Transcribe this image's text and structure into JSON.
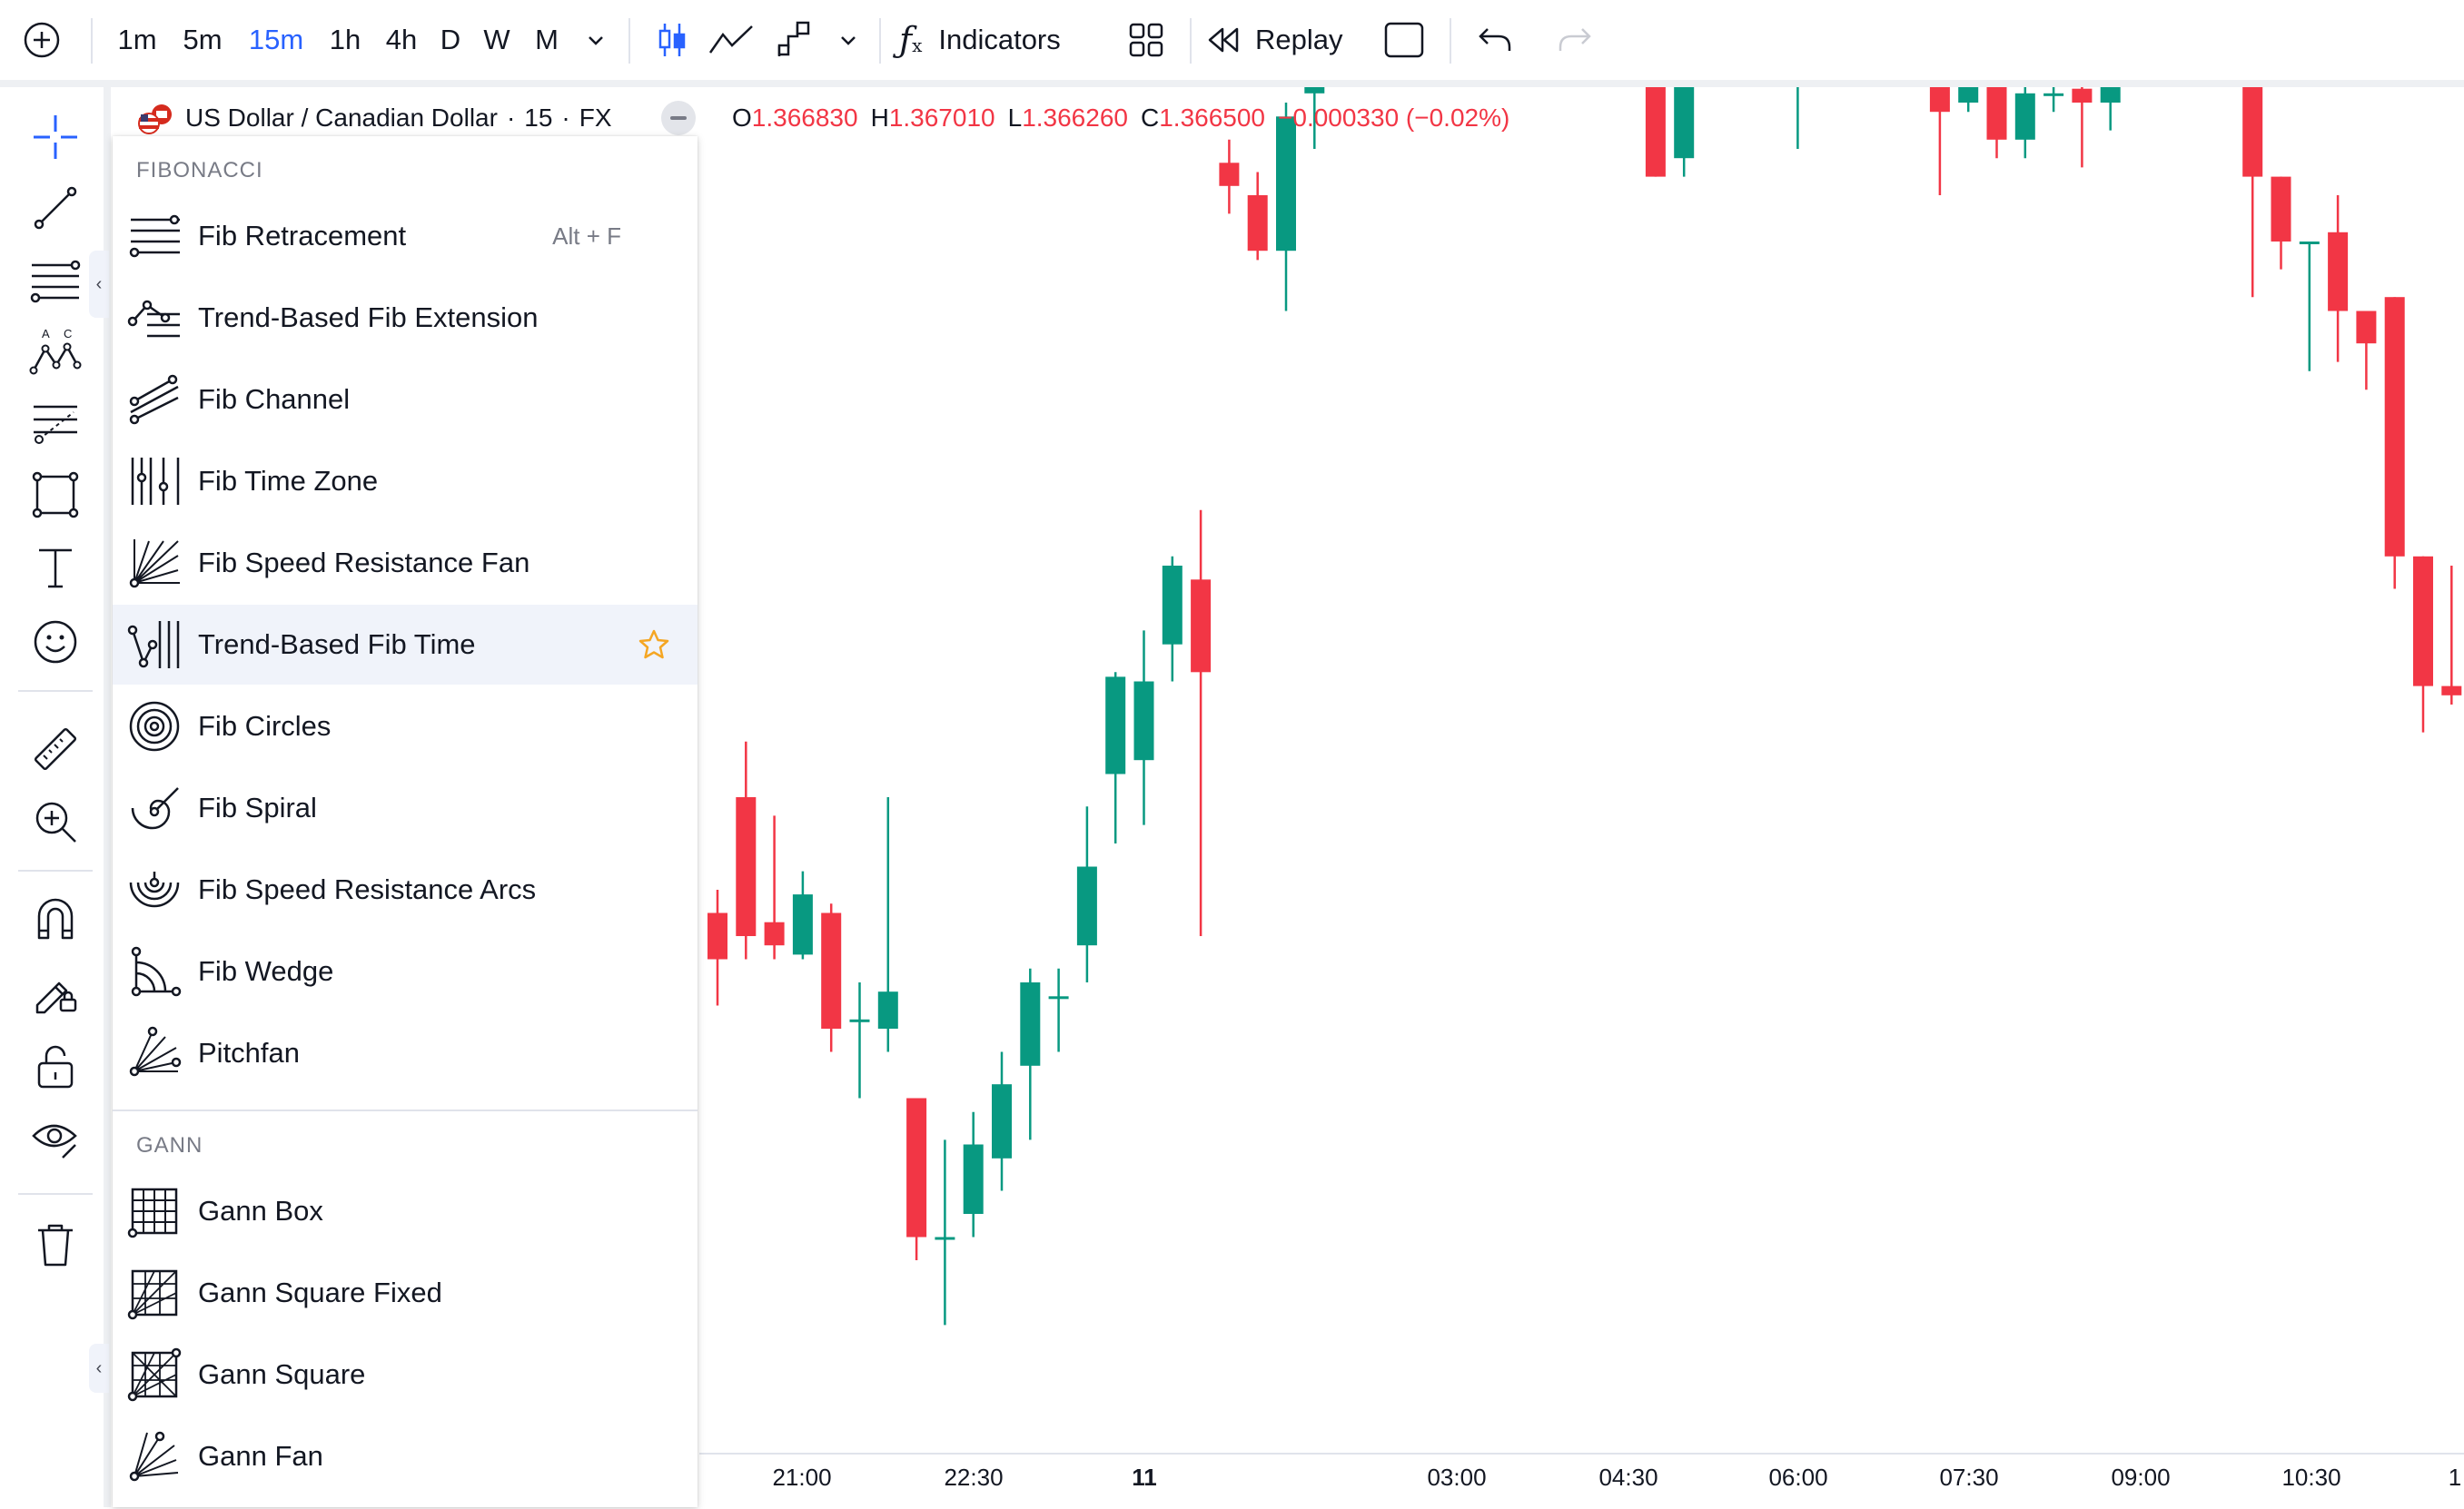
{
  "toolbar": {
    "intervals": [
      "1m",
      "5m",
      "15m",
      "1h",
      "4h",
      "D",
      "W",
      "M"
    ],
    "active_interval": "15m",
    "indicators_label": "Indicators",
    "replay_label": "Replay",
    "accent_color": "#2962ff"
  },
  "symbol": {
    "name": "US Dollar / Canadian Dollar",
    "interval": "15",
    "exchange": "FX",
    "open_key": "O",
    "open": "1.366830",
    "high_key": "H",
    "high": "1.367010",
    "low_key": "L",
    "low": "1.366260",
    "close_key": "C",
    "close": "1.366500",
    "change": "−0.000330 (−0.02%)"
  },
  "menu": {
    "fibonacci_title": "FIBONACCI",
    "fibonacci_items": [
      {
        "label": "Fib Retracement",
        "shortcut": "Alt + F",
        "icon": "fib-retracement-icon"
      },
      {
        "label": "Trend-Based Fib Extension",
        "icon": "trend-fib-extension-icon"
      },
      {
        "label": "Fib Channel",
        "icon": "fib-channel-icon"
      },
      {
        "label": "Fib Time Zone",
        "icon": "fib-time-zone-icon"
      },
      {
        "label": "Fib Speed Resistance Fan",
        "icon": "fib-speed-fan-icon"
      },
      {
        "label": "Trend-Based Fib Time",
        "icon": "trend-fib-time-icon",
        "highlighted": true
      },
      {
        "label": "Fib Circles",
        "icon": "fib-circles-icon"
      },
      {
        "label": "Fib Spiral",
        "icon": "fib-spiral-icon"
      },
      {
        "label": "Fib Speed Resistance Arcs",
        "icon": "fib-arcs-icon"
      },
      {
        "label": "Fib Wedge",
        "icon": "fib-wedge-icon"
      },
      {
        "label": "Pitchfan",
        "icon": "pitchfan-icon"
      }
    ],
    "gann_title": "GANN",
    "gann_items": [
      {
        "label": "Gann Box",
        "icon": "gann-box-icon"
      },
      {
        "label": "Gann Square Fixed",
        "icon": "gann-square-fixed-icon"
      },
      {
        "label": "Gann Square",
        "icon": "gann-square-icon"
      },
      {
        "label": "Gann Fan",
        "icon": "gann-fan-icon"
      }
    ]
  },
  "chart_data": {
    "type": "candlestick",
    "x_ticks": [
      "21:00",
      "22:30",
      "11",
      "03:00",
      "04:30",
      "06:00",
      "07:30",
      "09:00",
      "10:30",
      "1"
    ],
    "up_color": "#089981",
    "down_color": "#f23645",
    "ylim": [
      1.3652,
      1.3672
    ],
    "candles": [
      {
        "o": 1.36575,
        "h": 1.3658,
        "l": 1.36555,
        "c": 1.36565
      },
      {
        "o": 1.366,
        "h": 1.36612,
        "l": 1.36565,
        "c": 1.3657
      },
      {
        "o": 1.36573,
        "h": 1.36596,
        "l": 1.36565,
        "c": 1.36568
      },
      {
        "o": 1.36566,
        "h": 1.36584,
        "l": 1.36565,
        "c": 1.36579
      },
      {
        "o": 1.36575,
        "h": 1.36577,
        "l": 1.36545,
        "c": 1.3655
      },
      {
        "o": 1.36552,
        "h": 1.3656,
        "l": 1.36535,
        "c": 1.36552
      },
      {
        "o": 1.3655,
        "h": 1.366,
        "l": 1.36545,
        "c": 1.36558
      },
      {
        "o": 1.36535,
        "h": 1.36535,
        "l": 1.365,
        "c": 1.36505
      },
      {
        "o": 1.36505,
        "h": 1.36526,
        "l": 1.36486,
        "c": 1.36505
      },
      {
        "o": 1.3651,
        "h": 1.36532,
        "l": 1.36505,
        "c": 1.36525
      },
      {
        "o": 1.36522,
        "h": 1.36545,
        "l": 1.36515,
        "c": 1.36538
      },
      {
        "o": 1.36542,
        "h": 1.36563,
        "l": 1.36526,
        "c": 1.3656
      },
      {
        "o": 1.36557,
        "h": 1.36563,
        "l": 1.36545,
        "c": 1.36557
      },
      {
        "o": 1.36568,
        "h": 1.36598,
        "l": 1.3656,
        "c": 1.36585
      },
      {
        "o": 1.36605,
        "h": 1.36627,
        "l": 1.3659,
        "c": 1.36626
      },
      {
        "o": 1.36608,
        "h": 1.36636,
        "l": 1.36594,
        "c": 1.36625
      },
      {
        "o": 1.36633,
        "h": 1.36652,
        "l": 1.36625,
        "c": 1.3665
      },
      {
        "o": 1.36647,
        "h": 1.36662,
        "l": 1.3657,
        "c": 1.36627
      },
      {
        "o": 1.36737,
        "h": 1.36742,
        "l": 1.36726,
        "c": 1.36732
      },
      {
        "o": 1.3673,
        "h": 1.36735,
        "l": 1.36716,
        "c": 1.36718
      },
      {
        "o": 1.36718,
        "h": 1.3675,
        "l": 1.36705,
        "c": 1.36747
      },
      {
        "o": 1.36752,
        "h": 1.36835,
        "l": 1.3674,
        "c": 1.36834
      },
      {
        "o": 1.36837,
        "h": 1.36842,
        "l": 1.3681,
        "c": 1.3683
      },
      {
        "o": 1.36828,
        "h": 1.3685,
        "l": 1.36826,
        "c": 1.36836
      },
      {
        "o": 1.36833,
        "h": 1.36838,
        "l": 1.36828,
        "c": 1.36833
      },
      {
        "o": 1.36833,
        "h": 1.3687,
        "l": 1.36828,
        "c": 1.36867
      },
      {
        "o": 1.36867,
        "h": 1.36897,
        "l": 1.3685,
        "c": 1.36885
      },
      {
        "o": 1.36886,
        "h": 1.36893,
        "l": 1.36873,
        "c": 1.36879
      },
      {
        "o": 1.36879,
        "h": 1.36883,
        "l": 1.36863,
        "c": 1.36862
      },
      {
        "o": 1.36865,
        "h": 1.36893,
        "l": 1.36858,
        "c": 1.36869
      },
      {
        "o": 1.36872,
        "h": 1.36872,
        "l": 1.36808,
        "c": 1.36812
      },
      {
        "o": 1.3681,
        "h": 1.36812,
        "l": 1.3678,
        "c": 1.36798
      },
      {
        "o": 1.36805,
        "h": 1.36805,
        "l": 1.3676,
        "c": 1.36771
      },
      {
        "o": 1.36772,
        "h": 1.36772,
        "l": 1.36734,
        "c": 1.36734
      },
      {
        "o": 1.36738,
        "h": 1.36773,
        "l": 1.36734,
        "c": 1.36772
      },
      {
        "o": 1.36768,
        "h": 1.36808,
        "l": 1.36768,
        "c": 1.36806
      },
      {
        "o": 1.36808,
        "h": 1.36813,
        "l": 1.36772,
        "c": 1.36776
      },
      {
        "o": 1.36778,
        "h": 1.36778,
        "l": 1.36756,
        "c": 1.36763
      },
      {
        "o": 1.36762,
        "h": 1.36762,
        "l": 1.3674,
        "c": 1.36762
      },
      {
        "o": 1.36762,
        "h": 1.36778,
        "l": 1.36758,
        "c": 1.36767
      },
      {
        "o": 1.36767,
        "h": 1.36767,
        "l": 1.36758,
        "c": 1.36764
      },
      {
        "o": 1.36765,
        "h": 1.3678,
        "l": 1.36762,
        "c": 1.36773
      },
      {
        "o": 1.36772,
        "h": 1.36777,
        "l": 1.36767,
        "c": 1.36768
      },
      {
        "o": 1.36768,
        "h": 1.36768,
        "l": 1.3673,
        "c": 1.36748
      },
      {
        "o": 1.3675,
        "h": 1.36761,
        "l": 1.36748,
        "c": 1.36758
      },
      {
        "o": 1.36758,
        "h": 1.3676,
        "l": 1.36738,
        "c": 1.36742
      },
      {
        "o": 1.36742,
        "h": 1.36755,
        "l": 1.36738,
        "c": 1.36752
      },
      {
        "o": 1.36752,
        "h": 1.36767,
        "l": 1.36748,
        "c": 1.36752
      },
      {
        "o": 1.36753,
        "h": 1.3676,
        "l": 1.36736,
        "c": 1.3675
      },
      {
        "o": 1.3675,
        "h": 1.36775,
        "l": 1.36744,
        "c": 1.3677
      },
      {
        "o": 1.3677,
        "h": 1.36778,
        "l": 1.3676,
        "c": 1.36765
      },
      {
        "o": 1.36768,
        "h": 1.36775,
        "l": 1.36763,
        "c": 1.36762
      },
      {
        "o": 1.36762,
        "h": 1.36779,
        "l": 1.3676,
        "c": 1.36772
      },
      {
        "o": 1.36773,
        "h": 1.36777,
        "l": 1.36762,
        "c": 1.36765
      },
      {
        "o": 1.36765,
        "h": 1.36765,
        "l": 1.36708,
        "c": 1.36734
      },
      {
        "o": 1.36734,
        "h": 1.36734,
        "l": 1.36714,
        "c": 1.3672
      },
      {
        "o": 1.3672,
        "h": 1.3672,
        "l": 1.36692,
        "c": 1.3672
      },
      {
        "o": 1.36722,
        "h": 1.3673,
        "l": 1.36694,
        "c": 1.36705
      },
      {
        "o": 1.36705,
        "h": 1.36705,
        "l": 1.36688,
        "c": 1.36698
      },
      {
        "o": 1.36708,
        "h": 1.36708,
        "l": 1.36645,
        "c": 1.36652
      },
      {
        "o": 1.36652,
        "h": 1.36652,
        "l": 1.36614,
        "c": 1.36624
      },
      {
        "o": 1.36624,
        "h": 1.3665,
        "l": 1.3662,
        "c": 1.36622
      },
      {
        "o": 1.36624,
        "h": 1.36649,
        "l": 1.3661,
        "c": 1.36641
      },
      {
        "o": 1.3664,
        "h": 1.36648,
        "l": 1.36625,
        "c": 1.3663
      }
    ]
  }
}
